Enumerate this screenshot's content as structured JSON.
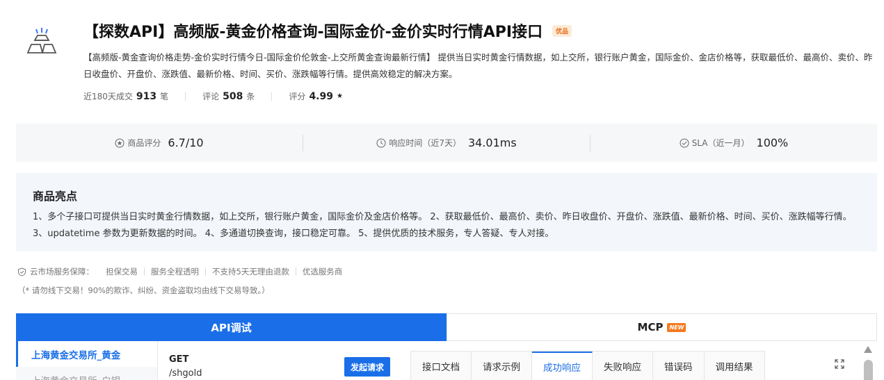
{
  "product": {
    "title": "【探数API】高频版-黄金价格查询-国际金价-金价实时行情API接口",
    "badge": "优品",
    "description": "【高频版-黄金查询价格走势-金价实时行情今日-国际金价伦敦金-上交所黄金查询最新行情】 提供当日实时黄金行情数据，如上交所，银行账户黄金，国际金价、金店价格等，获取最低价、最高价、卖价、昨日收盘价、开盘价、涨跌值、最新价格、时间、买价、涨跌幅等行情。提供高效稳定的解决方案。",
    "stats": [
      {
        "label": "近180天成交",
        "value": "913",
        "unit": "笔"
      },
      {
        "label": "评论",
        "value": "508",
        "unit": "条"
      },
      {
        "label": "评分",
        "value": "4.99",
        "unit": "★"
      }
    ]
  },
  "metrics": [
    {
      "icon": "star-circle-icon",
      "label": "商品评分",
      "value": "6.7/10"
    },
    {
      "icon": "clock-icon",
      "label": "响应时间（近7天）",
      "value": "34.01ms"
    },
    {
      "icon": "check-circle-icon",
      "label": "SLA（近一月）",
      "value": "100%"
    }
  ],
  "highlights": {
    "title": "商品亮点",
    "text": "1、多个子接口可提供当日实时黄金行情数据，如上交所，银行账户黄金，国际金价及金店价格等。 2、获取最低价、最高价、卖价、昨日收盘价、开盘价、涨跌值、最新价格、时间、买价、涨跌幅等行情。 3、updatetime 参数为更新数据的时间。 4、多通道切换查询，接口稳定可靠。 5、提供优质的技术服务，专人答疑、专人对接。"
  },
  "guarantee": {
    "label": "云市场服务保障：",
    "items": [
      "担保交易",
      "服务全程透明",
      "不支持5天无理由退款",
      "优选服务商"
    ],
    "warning": "（* 请勿线下交易！90%的欺诈、纠纷、资金盗取均由线下交易导致。）"
  },
  "tabs": {
    "api": "API调试",
    "mcp": "MCP",
    "mcp_badge": "NEW"
  },
  "api_list": [
    {
      "label": "上海黄金交易所_黄金",
      "active": true
    },
    {
      "label": "上海黄金交易所_白银",
      "active": false
    }
  ],
  "request": {
    "method": "GET",
    "path": "/shgold",
    "send_label": "发起请求"
  },
  "result_tabs": [
    "接口文档",
    "请求示例",
    "成功响应",
    "失败响应",
    "错误码",
    "调用结果"
  ],
  "active_result_tab": 2,
  "colors": {
    "accent": "#1a6fe8",
    "badge_orange": "#f47a1f"
  }
}
